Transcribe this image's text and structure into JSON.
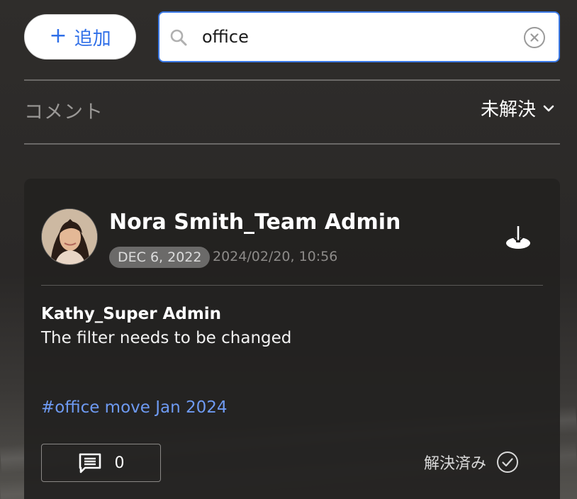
{
  "toolbar": {
    "add_label": "追加",
    "add_icon": "plus-icon"
  },
  "search": {
    "value": "office",
    "placeholder": "",
    "icon": "search-icon",
    "clear_icon": "clear-circle-icon"
  },
  "comments_header": {
    "title": "コメント",
    "filter_value": "未解決",
    "filter_icon": "chevron-down-icon"
  },
  "comment_card": {
    "author": "Nora Smith_Team Admin",
    "date_badge": "DEC 6, 2022",
    "timestamp": "2024/02/20, 10:56",
    "action_icon": "download-icon",
    "reply_author": "Kathy_Super Admin",
    "text": "The filter needs to be changed",
    "hashtag": "#office move Jan 2024",
    "replies_count": "0",
    "replies_icon": "comment-icon",
    "resolve_label": "解決済み",
    "resolve_icon": "check-circle-icon"
  },
  "colors": {
    "accent": "#3b79e6",
    "hashtag": "#6e9af2",
    "card_bg": "#222120",
    "background": "#2d2b2a"
  }
}
